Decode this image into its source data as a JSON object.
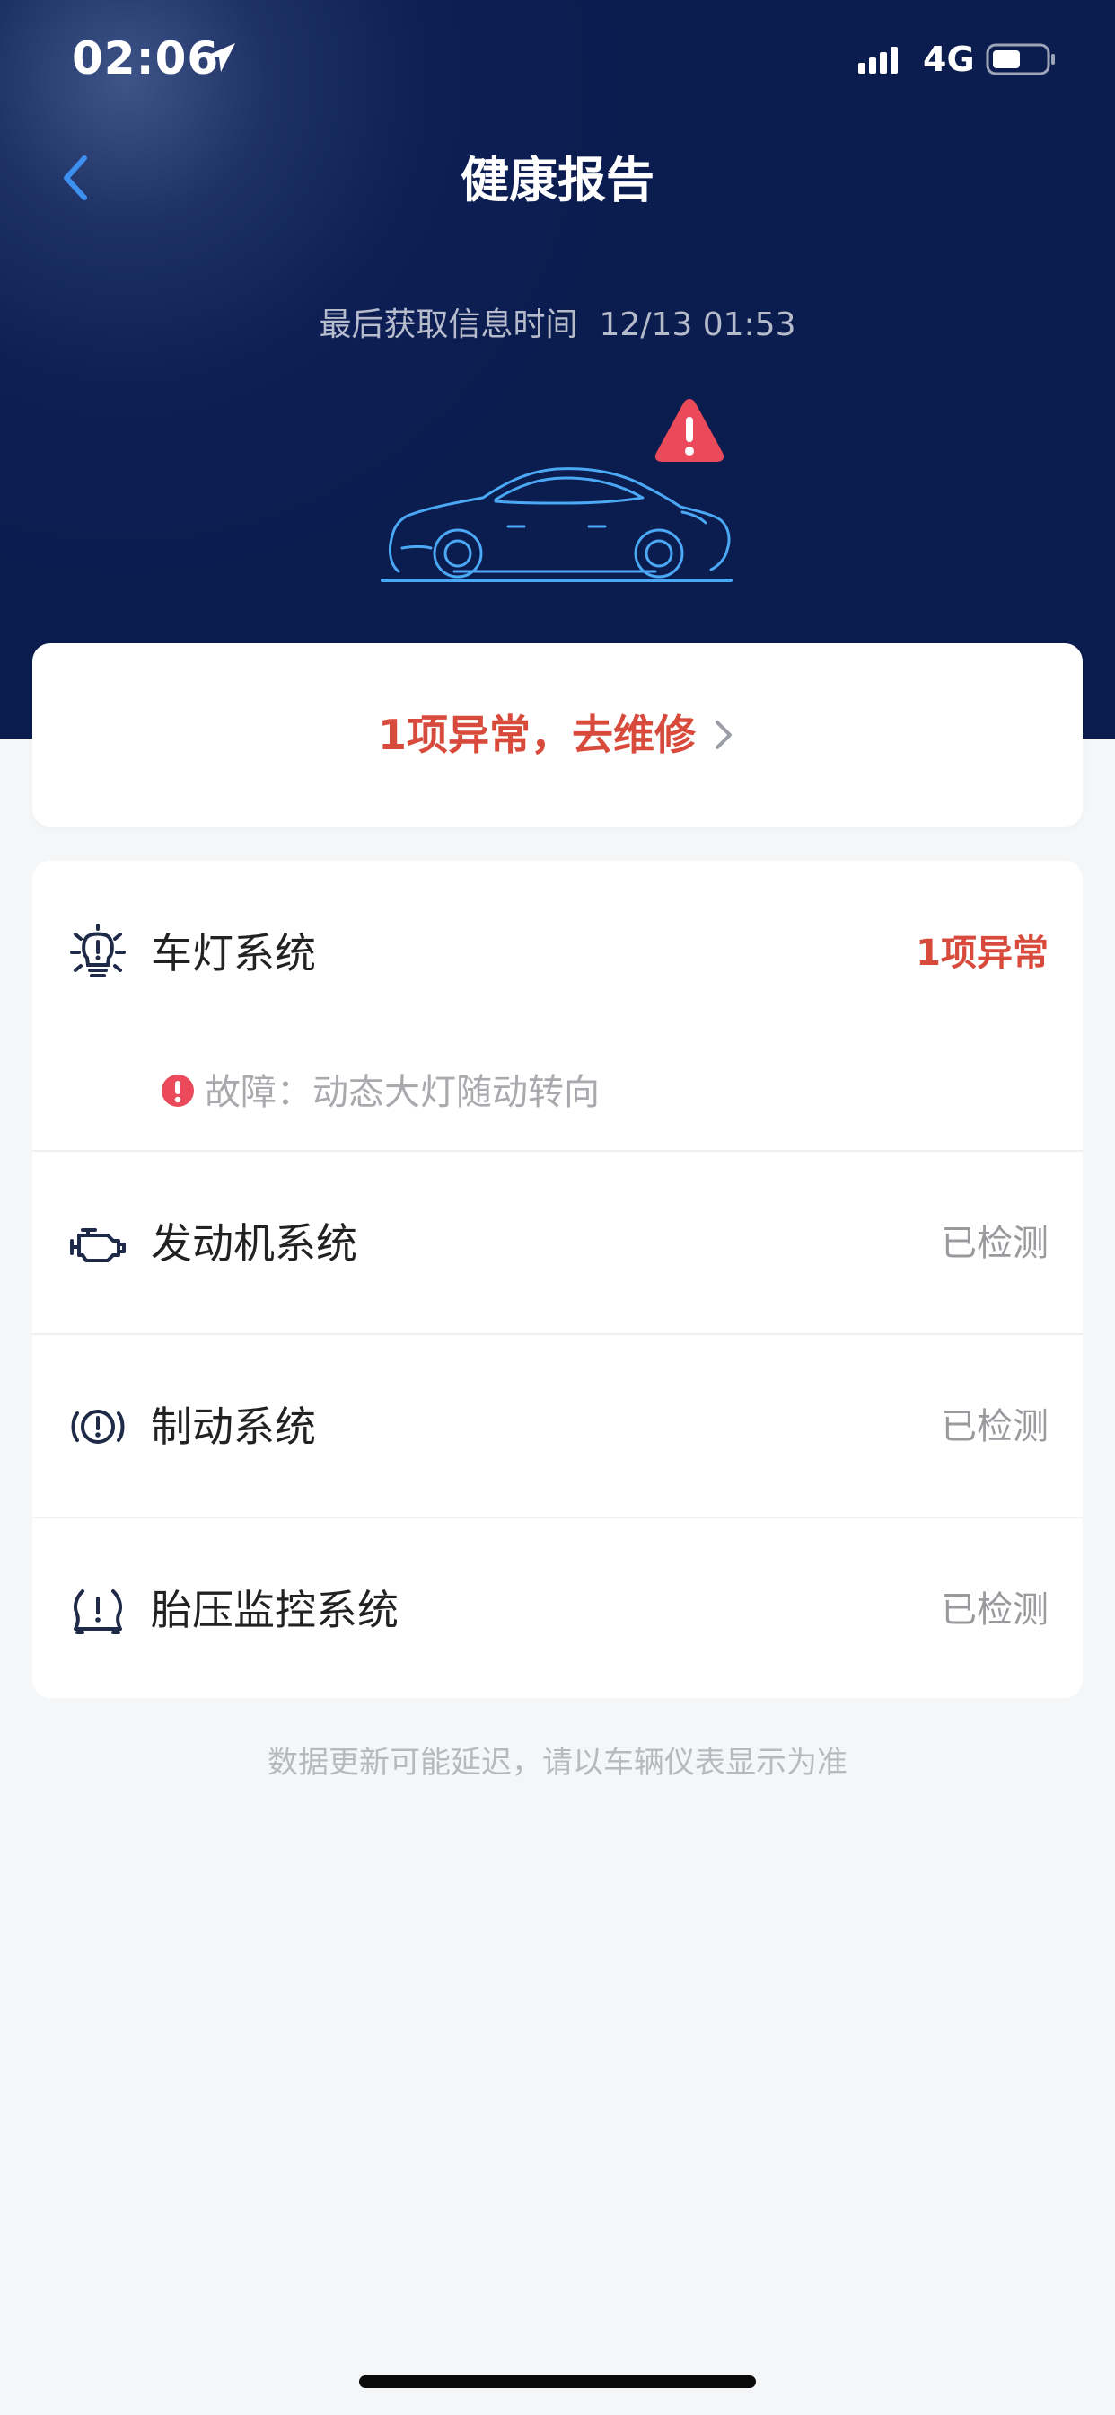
{
  "status_bar": {
    "time": "02:06",
    "network": "4G",
    "icons": [
      "location-arrow-icon",
      "signal-icon",
      "battery-icon"
    ]
  },
  "header": {
    "title": "健康报告",
    "back_icon": "chevron-left-icon",
    "last_update_label": "最后获取信息时间",
    "last_update_value": "12/13 01:53",
    "illustration": "car-outline",
    "warning_icon": "warning-triangle-icon"
  },
  "repair_card": {
    "label": "1项异常，去维修",
    "icon": "chevron-right-icon"
  },
  "systems": [
    {
      "icon": "lamp-icon",
      "label": "车灯系统",
      "status": "1项异常",
      "fault": {
        "icon": "exclamation-circle-icon",
        "text": "故障：动态大灯随动转向"
      }
    },
    {
      "icon": "engine-icon",
      "label": "发动机系统",
      "status": "已检测"
    },
    {
      "icon": "brake-icon",
      "label": "制动系统",
      "status": "已检测"
    },
    {
      "icon": "tire-pressure-icon",
      "label": "胎压监控系统",
      "status": "已检测"
    }
  ],
  "footnote": "数据更新可能延迟，请以车辆仪表显示为准",
  "colors": {
    "header_bg": "#0b1c4f",
    "alert": "#d84a3b",
    "accent_blue": "#3d8ff0",
    "page_bg": "#f5f6f8"
  }
}
